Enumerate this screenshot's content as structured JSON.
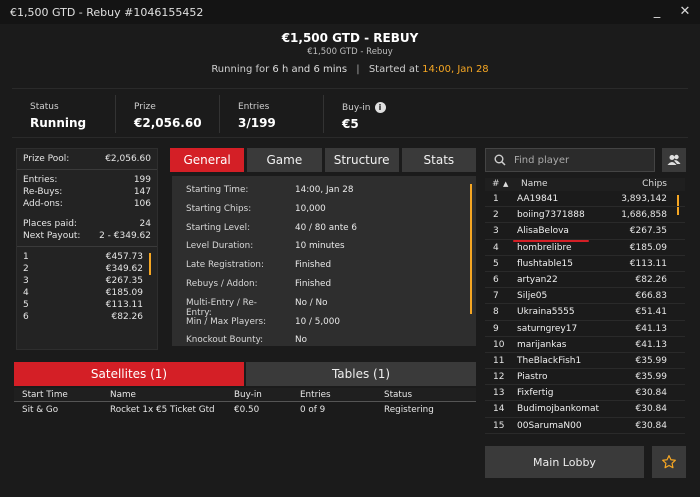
{
  "window": {
    "title": "€1,500 GTD - Rebuy #1046155452",
    "minimize_label": "_",
    "close_label": "✕"
  },
  "header": {
    "title": "€1,500 GTD - REBUY",
    "subtitle": "€1,500 GTD - Rebuy",
    "running_label": "Running for",
    "running_value": "6 h and 6 mins",
    "separator": "|",
    "started_label": "Started at",
    "started_value": "14:00, Jan 28"
  },
  "stats": [
    {
      "label": "Status",
      "value": "Running"
    },
    {
      "label": "Prize",
      "value": "€2,056.60"
    },
    {
      "label": "Entries",
      "value": "3/199"
    },
    {
      "label": "Buy-in",
      "value": "€5"
    }
  ],
  "prize_panel": {
    "prize_pool_label": "Prize Pool:",
    "prize_pool_value": "€2,056.60",
    "entries_label": "Entries:",
    "entries_value": "199",
    "rebuys_label": "Re-Buys:",
    "rebuys_value": "147",
    "addons_label": "Add-ons:",
    "addons_value": "106",
    "places_paid_label": "Places paid:",
    "places_paid_value": "24",
    "next_payout_label": "Next Payout:",
    "next_payout_value": "2 - €349.62",
    "payouts": [
      {
        "place": "1",
        "amount": "€457.73"
      },
      {
        "place": "2",
        "amount": "€349.62"
      },
      {
        "place": "3",
        "amount": "€267.35"
      },
      {
        "place": "4",
        "amount": "€185.09"
      },
      {
        "place": "5",
        "amount": "€113.11"
      },
      {
        "place": "6",
        "amount": "€82.26"
      }
    ]
  },
  "tabs": [
    "General",
    "Game",
    "Structure",
    "Stats"
  ],
  "general": [
    {
      "key": "Starting Time:",
      "value": "14:00, Jan 28"
    },
    {
      "key": "Starting Chips:",
      "value": "10,000"
    },
    {
      "key": "Starting Level:",
      "value": "40 / 80 ante 6"
    },
    {
      "key": "Level Duration:",
      "value": "10 minutes"
    },
    {
      "key": "Late Registration:",
      "value": "Finished"
    },
    {
      "key": "Rebuys / Addon:",
      "value": "Finished"
    },
    {
      "key": "Multi-Entry / Re-Entry:",
      "value": "No / No"
    },
    {
      "key": "Min / Max Players:",
      "value": "10 / 5,000"
    },
    {
      "key": "Knockout Bounty:",
      "value": "No"
    }
  ],
  "sat_tabs": [
    "Satellites (1)",
    "Tables (1)"
  ],
  "satellites": {
    "headers": [
      "Start Time",
      "Name",
      "Buy-in",
      "Entries",
      "Status"
    ],
    "rows": [
      [
        "Sit & Go",
        "Rocket 1x €5 Ticket Gtd",
        "€0.50",
        "0 of 9",
        "Registering"
      ]
    ]
  },
  "search": {
    "placeholder": "Find player"
  },
  "players": {
    "headers": {
      "num": "#",
      "sort": "▲",
      "name": "Name",
      "chips": "Chips"
    },
    "rows": [
      {
        "n": "1",
        "name": "AA19841",
        "chips": "3,893,142"
      },
      {
        "n": "2",
        "name": "boiing7371888",
        "chips": "1,686,858"
      },
      {
        "n": "3",
        "name": "AlisaBelova",
        "chips": "€267.35"
      },
      {
        "n": "4",
        "name": "hombrelibre",
        "chips": "€185.09"
      },
      {
        "n": "5",
        "name": "flushtable15",
        "chips": "€113.11"
      },
      {
        "n": "6",
        "name": "artyan22",
        "chips": "€82.26"
      },
      {
        "n": "7",
        "name": "Silje05",
        "chips": "€66.83"
      },
      {
        "n": "8",
        "name": "Ukraina5555",
        "chips": "€51.41"
      },
      {
        "n": "9",
        "name": "saturngrey17",
        "chips": "€41.13"
      },
      {
        "n": "10",
        "name": "marijankas",
        "chips": "€41.13"
      },
      {
        "n": "11",
        "name": "TheBlackFish1",
        "chips": "€35.99"
      },
      {
        "n": "12",
        "name": "Piastro",
        "chips": "€35.99"
      },
      {
        "n": "13",
        "name": "Fixfertig",
        "chips": "€30.84"
      },
      {
        "n": "14",
        "name": "Budimojbankomat",
        "chips": "€30.84"
      },
      {
        "n": "15",
        "name": "00SarumaN00",
        "chips": "€30.84"
      }
    ]
  },
  "main_lobby_label": "Main Lobby",
  "colors": {
    "accent_red": "#d41f26",
    "highlight_orange": "#f5a623",
    "background": "#1b1b1b"
  }
}
